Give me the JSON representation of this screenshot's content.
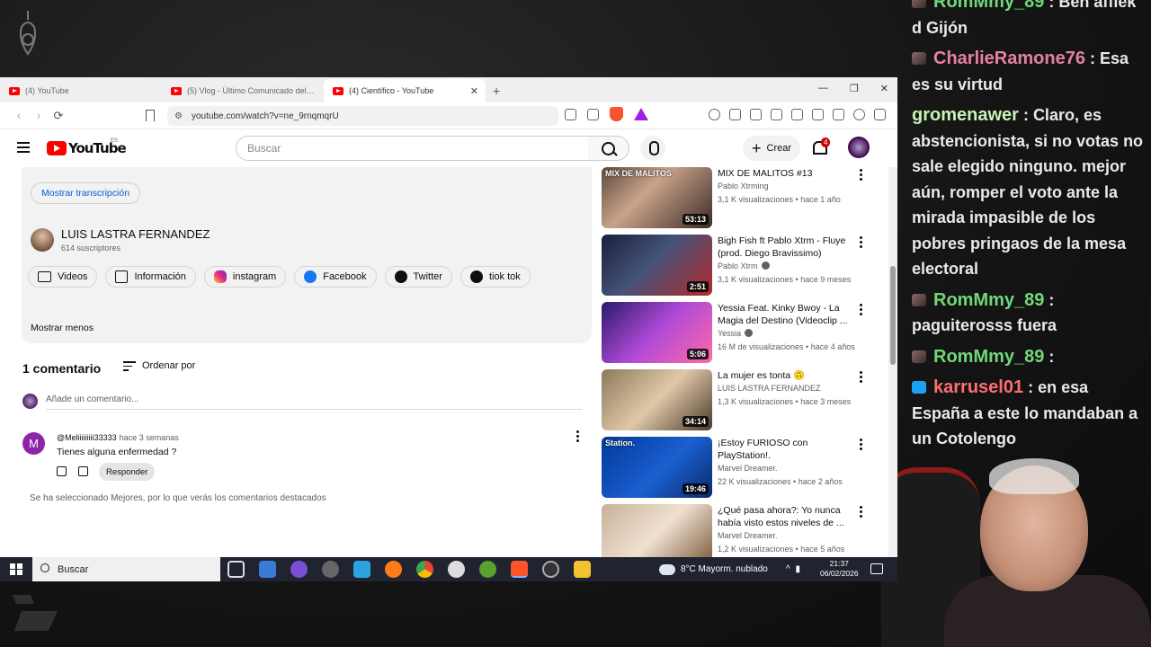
{
  "stream": {
    "chat": [
      {
        "user": "RomMmy_89",
        "text": "Ben afflek d Gijón",
        "color": "u-green",
        "badge": "normal"
      },
      {
        "user": "CharlieRamone76",
        "text": "Esa es su virtud",
        "color": "u-pink",
        "badge": "normal"
      },
      {
        "user": "gromenawer",
        "text": "Claro, es abstencionista, si no votas no sale elegido ninguno. mejor aún, romper el voto ante la mirada impasible de los pobres pringaos de la mesa electoral",
        "color": "u-light",
        "badge": "none"
      },
      {
        "user": "RomMmy_89",
        "text": "paguiterosss fuera",
        "color": "u-green",
        "badge": "normal"
      },
      {
        "user": "RomMmy_89",
        "text": "",
        "color": "u-green",
        "badge": "normal"
      },
      {
        "user": "karrusel01",
        "text": "en esa España a este lo mandaban a un Cotolengo",
        "color": "u-red",
        "badge": "blue"
      }
    ]
  },
  "browser": {
    "tabs": [
      {
        "title": "(4) YouTube",
        "active": false
      },
      {
        "title": "(5) Vlog - Último Comunicado del día",
        "active": false
      },
      {
        "title": "(4) Científico - YouTube",
        "active": true
      }
    ],
    "close_glyph": "✕",
    "newtab_glyph": "+",
    "window_controls": [
      "—",
      "❐",
      "✕"
    ],
    "url": "youtube.com/watch?v=ne_9rnqmqrU",
    "nav": {
      "back": "‹",
      "forward": "›",
      "reload": "⟳"
    }
  },
  "youtube": {
    "logo_text": "YouTube",
    "country_code": "ES",
    "search_placeholder": "Buscar",
    "create_label": "Crear",
    "notification_count": "4",
    "description": {
      "transcript_button": "Mostrar transcripción",
      "channel_name": "LUIS LASTRA FERNANDEZ",
      "subscribers": "614 suscriptores",
      "links": [
        {
          "label": "Videos",
          "icon": "video-icon"
        },
        {
          "label": "Información",
          "icon": "info-icon"
        },
        {
          "label": "instagram",
          "icon": "instagram-icon"
        },
        {
          "label": "Facebook",
          "icon": "facebook-icon"
        },
        {
          "label": "Twitter",
          "icon": "x-icon"
        },
        {
          "label": "tiok tok",
          "icon": "tiktok-icon"
        }
      ],
      "show_less": "Mostrar menos"
    },
    "comments": {
      "title": "1 comentario",
      "sort_label": "Ordenar por",
      "add_placeholder": "Añade un comentario...",
      "items": [
        {
          "avatar_letter": "M",
          "author": "@Meliiiiiiiii33333",
          "time": "hace 3 semanas",
          "text": "Tienes alguna enfermedad ?",
          "reply_label": "Responder"
        }
      ],
      "note": "Se ha seleccionado Mejores, por lo que verás los comentarios destacados"
    },
    "recommendations": [
      {
        "title": "MIX DE MALITOS #13",
        "channel": "Pablo Xtrming",
        "verified": false,
        "meta": "3,1 K visualizaciones • hace 1 año",
        "duration": "53:13",
        "thumb": "linear-gradient(135deg,#5b4a3a 0%,#c9a38a 40%,#3b2a28 100%)",
        "thumb_label": "MIX DE MALITOS"
      },
      {
        "title": "Bigh Fish ft Pablo Xtrm - Fluye (prod. Diego Bravissimo)",
        "channel": "Pablo Xtrm",
        "verified": true,
        "meta": "3,1 K visualizaciones • hace 9 meses",
        "duration": "2:51",
        "thumb": "linear-gradient(135deg,#1a1f3a 0%,#45527a 45%,#b22a2a 100%)",
        "thumb_label": ""
      },
      {
        "title": "Yessia Feat. Kinky Bwoy - La Magia del Destino (Videoclip ...",
        "channel": "Yessia",
        "verified": true,
        "meta": "16 M de visualizaciones • hace 4 años",
        "duration": "5:06",
        "thumb": "linear-gradient(135deg,#2a1a6a 0%,#b04ad8 50%,#ff6aa8 100%)",
        "thumb_label": ""
      },
      {
        "title": "La mujer es tonta 🙃",
        "channel": "LUIS LASTRA FERNANDEZ",
        "verified": false,
        "meta": "1,3 K visualizaciones • hace 3 meses",
        "duration": "34:14",
        "thumb": "linear-gradient(135deg,#8a7a5a 0%,#e0c8a8 50%,#4a3a2a 100%)",
        "thumb_label": ""
      },
      {
        "title": "¡Estoy FURIOSO con PlayStation!.",
        "channel": "Marvel Dreamer.",
        "verified": false,
        "meta": "22 K visualizaciones • hace 2 años",
        "duration": "19:46",
        "thumb": "linear-gradient(135deg,#003a9b 0%,#1b5fd0 55%,#0a2a6a 100%)",
        "thumb_label": "Station."
      },
      {
        "title": "¿Qué pasa ahora?: Yo nunca había visto estos niveles de ...",
        "channel": "Marvel Dreamer.",
        "verified": false,
        "meta": "1,2 K visualizaciones • hace 5 años",
        "duration": "",
        "thumb": "linear-gradient(135deg,#c8b098 0%,#f0e0d0 50%,#7a5a3a 100%)",
        "thumb_label": ""
      }
    ]
  },
  "taskbar": {
    "search_placeholder": "Buscar",
    "weather": "8°C  Mayorm. nublado",
    "time": "21:37",
    "date": "06/02/2026",
    "tray_arrow": "^"
  }
}
